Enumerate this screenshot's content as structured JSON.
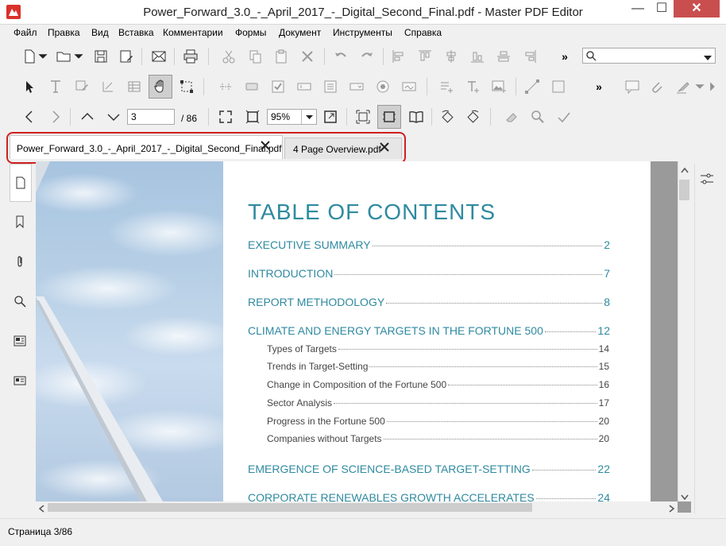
{
  "window": {
    "title": "Power_Forward_3.0_-_April_2017_-_Digital_Second_Final.pdf - Master PDF Editor",
    "minimize": "—",
    "maximize": "☐",
    "close": "✕"
  },
  "menu": [
    "Файл",
    "Правка",
    "Вид",
    "Вставка",
    "Комментарии",
    "Формы",
    "Документ",
    "Инструменты",
    "Справка"
  ],
  "navigation": {
    "current_page": "3",
    "total_pages": "/ 86",
    "zoom": "95%"
  },
  "overflow_label": "»",
  "tabs": [
    {
      "label": "Power_Forward_3.0_-_April_2017_-_Digital_Second_Final.pdf",
      "active": true
    },
    {
      "label": "4 Page Overview.pdf",
      "active": false
    }
  ],
  "document": {
    "toc_title": "TABLE OF CONTENTS",
    "entries": [
      {
        "text": "EXECUTIVE SUMMARY",
        "page": "2"
      },
      {
        "text": "INTRODUCTION",
        "page": "7"
      },
      {
        "text": "REPORT METHODOLOGY",
        "page": "8"
      },
      {
        "text": "CLIMATE AND ENERGY TARGETS IN THE FORTUNE 500",
        "page": "12"
      },
      {
        "text": "EMERGENCE OF SCIENCE-BASED TARGET-SETTING",
        "page": "22"
      },
      {
        "text": "CORPORATE RENEWABLES GROWTH ACCELERATES",
        "page": "24"
      }
    ],
    "subentries": [
      {
        "text": "Types of Targets",
        "page": "14"
      },
      {
        "text": "Trends in Target-Setting",
        "page": "15"
      },
      {
        "text": "Change in Composition of the Fortune 500",
        "page": "16"
      },
      {
        "text": "Sector Analysis",
        "page": "17"
      },
      {
        "text": "Progress in the Fortune 500",
        "page": "20"
      },
      {
        "text": "Companies without Targets",
        "page": "20"
      }
    ]
  },
  "status": {
    "text": "Страница 3/86"
  },
  "colors": {
    "accent": "#2f8aa0",
    "close": "#c94f4f",
    "highlight": "#d02020"
  }
}
